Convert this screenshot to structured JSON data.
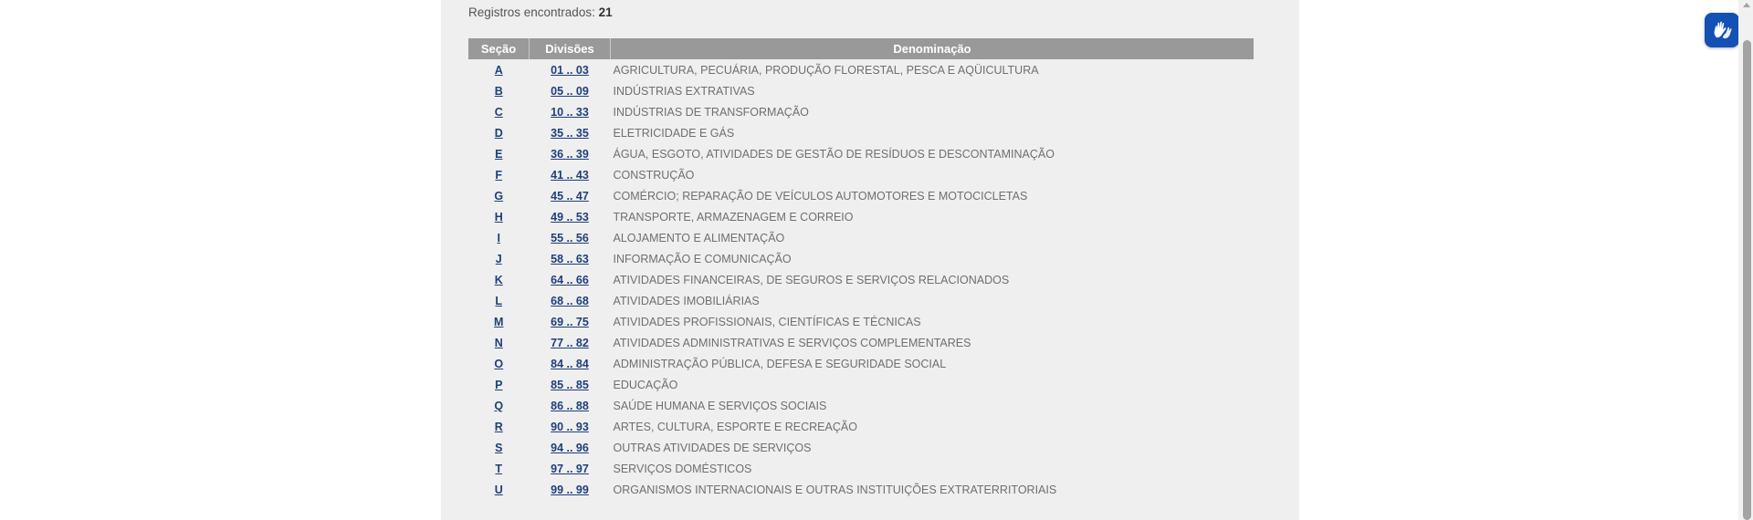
{
  "records": {
    "label": "Registros encontrados:",
    "count": "21"
  },
  "table": {
    "headers": {
      "secao": "Seção",
      "divisoes": "Divisões",
      "denominacao": "Denominação"
    },
    "rows": [
      {
        "secao": "A",
        "divisoes": "01 .. 03",
        "denominacao": "AGRICULTURA, PECUÁRIA, PRODUÇÃO FLORESTAL, PESCA E AQÜICULTURA"
      },
      {
        "secao": "B",
        "divisoes": "05 .. 09",
        "denominacao": "INDÚSTRIAS EXTRATIVAS"
      },
      {
        "secao": "C",
        "divisoes": "10 .. 33",
        "denominacao": "INDÚSTRIAS DE TRANSFORMAÇÃO"
      },
      {
        "secao": "D",
        "divisoes": "35 .. 35",
        "denominacao": "ELETRICIDADE E GÁS"
      },
      {
        "secao": "E",
        "divisoes": "36 .. 39",
        "denominacao": "ÁGUA, ESGOTO, ATIVIDADES DE GESTÃO DE RESÍDUOS E DESCONTAMINAÇÃO"
      },
      {
        "secao": "F",
        "divisoes": "41 .. 43",
        "denominacao": "CONSTRUÇÃO"
      },
      {
        "secao": "G",
        "divisoes": "45 .. 47",
        "denominacao": "COMÉRCIO; REPARAÇÃO DE VEÍCULOS AUTOMOTORES E MOTOCICLETAS"
      },
      {
        "secao": "H",
        "divisoes": "49 .. 53",
        "denominacao": "TRANSPORTE, ARMAZENAGEM E CORREIO"
      },
      {
        "secao": "I",
        "divisoes": "55 .. 56",
        "denominacao": "ALOJAMENTO E ALIMENTAÇÃO"
      },
      {
        "secao": "J",
        "divisoes": "58 .. 63",
        "denominacao": "INFORMAÇÃO E COMUNICAÇÃO"
      },
      {
        "secao": "K",
        "divisoes": "64 .. 66",
        "denominacao": "ATIVIDADES FINANCEIRAS, DE SEGUROS E SERVIÇOS RELACIONADOS"
      },
      {
        "secao": "L",
        "divisoes": "68 .. 68",
        "denominacao": "ATIVIDADES IMOBILIÁRIAS"
      },
      {
        "secao": "M",
        "divisoes": "69 .. 75",
        "denominacao": "ATIVIDADES PROFISSIONAIS, CIENTÍFICAS E TÉCNICAS"
      },
      {
        "secao": "N",
        "divisoes": "77 .. 82",
        "denominacao": "ATIVIDADES ADMINISTRATIVAS E SERVIÇOS COMPLEMENTARES"
      },
      {
        "secao": "O",
        "divisoes": "84 .. 84",
        "denominacao": "ADMINISTRAÇÃO PÚBLICA, DEFESA E SEGURIDADE SOCIAL"
      },
      {
        "secao": "P",
        "divisoes": "85 .. 85",
        "denominacao": "EDUCAÇÃO"
      },
      {
        "secao": "Q",
        "divisoes": "86 .. 88",
        "denominacao": "SAÚDE HUMANA E SERVIÇOS SOCIAIS"
      },
      {
        "secao": "R",
        "divisoes": "90 .. 93",
        "denominacao": "ARTES, CULTURA, ESPORTE E RECREAÇÃO"
      },
      {
        "secao": "S",
        "divisoes": "94 .. 96",
        "denominacao": "OUTRAS ATIVIDADES DE SERVIÇOS"
      },
      {
        "secao": "T",
        "divisoes": "97 .. 97",
        "denominacao": "SERVIÇOS DOMÉSTICOS"
      },
      {
        "secao": "U",
        "divisoes": "99 .. 99",
        "denominacao": "ORGANISMOS INTERNACIONAIS E OUTRAS INSTITUIÇÕES EXTRATERRITORIAIS"
      }
    ]
  },
  "widgets": {
    "accessibility_icon": "vlibras-hands-icon",
    "accent_color": "#1351b4",
    "link_color": "#1f3f7a",
    "header_color": "#999999"
  }
}
